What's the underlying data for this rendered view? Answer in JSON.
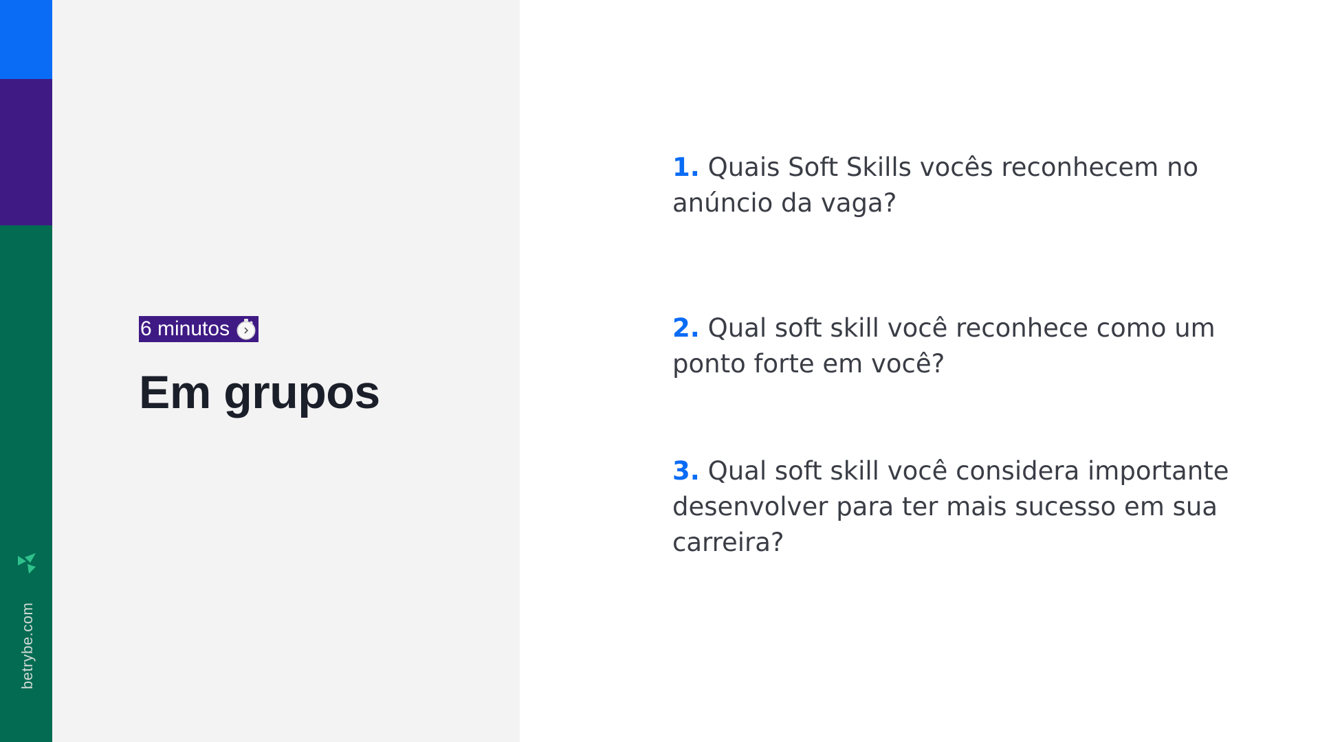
{
  "colors": {
    "strip_blue": "#0a6cf5",
    "strip_purple": "#3f1a84",
    "strip_green": "#036b52",
    "panel_bg": "#f3f3f3",
    "badge_bg": "#3f1a84",
    "number_blue": "#0a6cf5",
    "logo_green": "#2fc18c"
  },
  "brand": {
    "logo_icon": "trybe-logo-icon",
    "url": "betrybe.com"
  },
  "timer": {
    "label": "6 minutos",
    "icon": "stopwatch-icon"
  },
  "title": "Em grupos",
  "questions": [
    {
      "number": "1.",
      "text": "Quais Soft Skills vocês reconhecem no anúncio da vaga?"
    },
    {
      "number": "2.",
      "text": "Qual soft skill você reconhece como um ponto forte em você?"
    },
    {
      "number": "3.",
      "text": "Qual soft skill você considera importante desenvolver para ter mais sucesso em sua carreira?"
    }
  ]
}
